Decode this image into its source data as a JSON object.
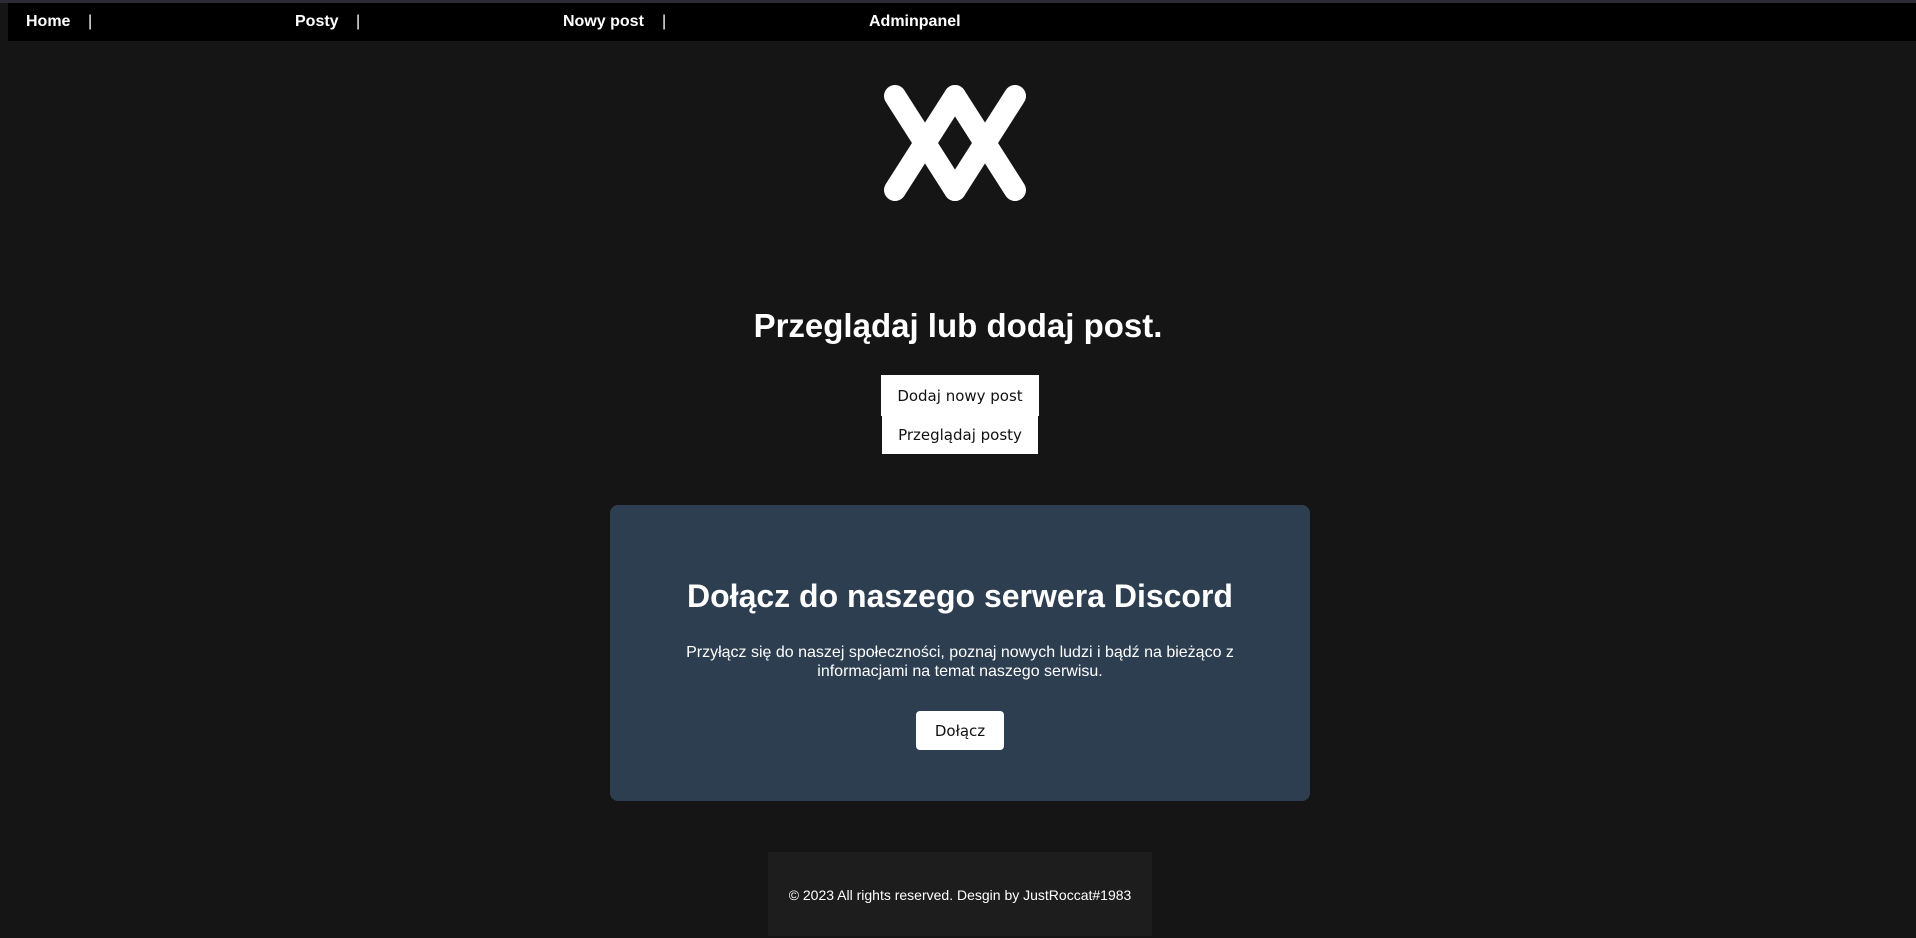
{
  "nav": {
    "items": [
      {
        "label": "Home"
      },
      {
        "label": "Posty"
      },
      {
        "label": "Nowy post"
      },
      {
        "label": "Adminpanel"
      }
    ],
    "separator": "|"
  },
  "logo": {
    "icon": "double-x-logo-icon"
  },
  "hero": {
    "headline": "Przeglądaj lub dodaj post.",
    "add_post_label": "Dodaj nowy post",
    "browse_posts_label": "Przeglądaj posty"
  },
  "discord": {
    "title": "Dołącz do naszego serwera Discord",
    "description": "Przyłącz się do naszej społeczności, poznaj nowych ludzi i bądź na bieżąco z informacjami na temat naszego serwisu.",
    "join_label": "Dołącz"
  },
  "footer": {
    "text": "© 2023 All rights reserved. Desgin by JustRoccat#1983"
  },
  "colors": {
    "page_background": "#151515",
    "nav_background": "#000000",
    "card_background": "#2d3e50",
    "button_background": "#ffffff",
    "footer_background": "#1d1d1d"
  }
}
